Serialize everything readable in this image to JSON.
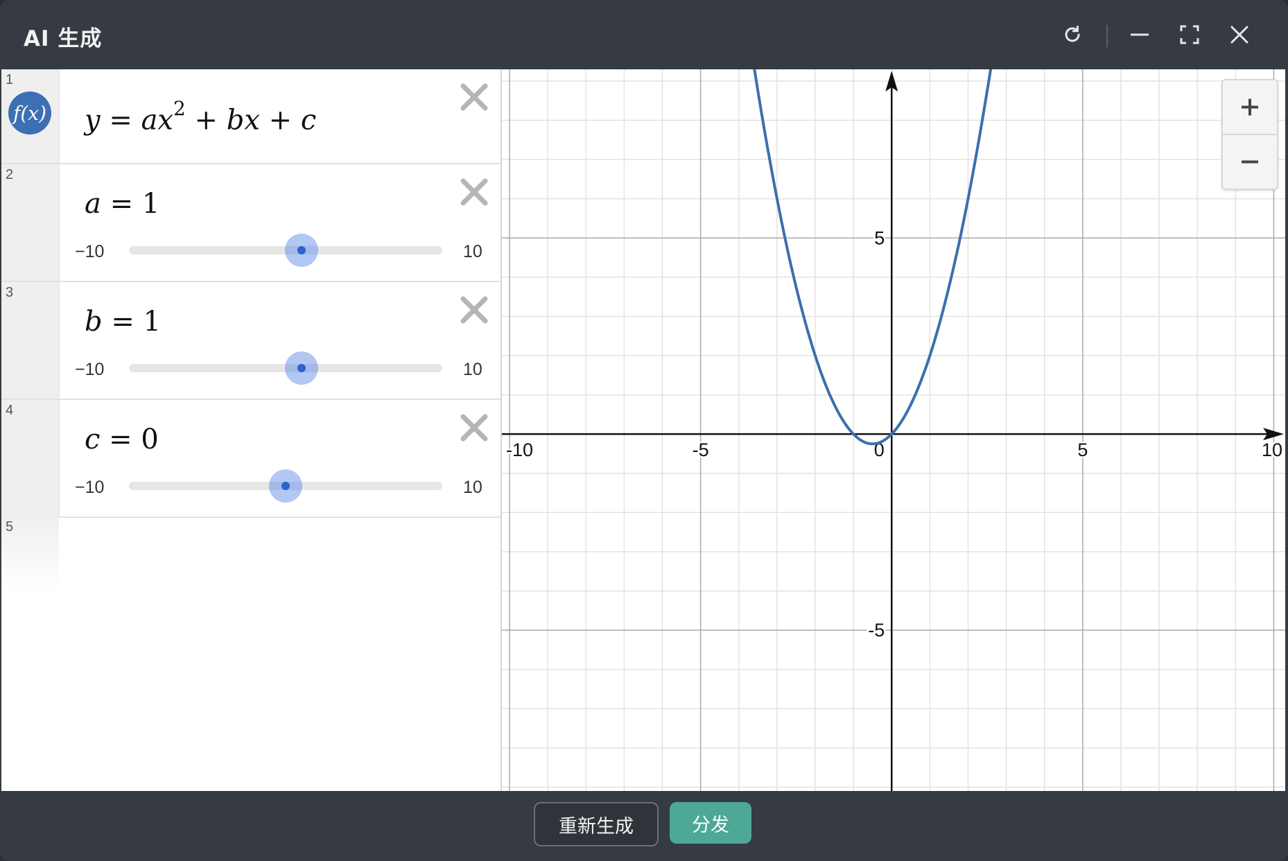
{
  "window": {
    "title": "AI 生成",
    "controls": [
      "refresh-icon",
      "minimize-icon",
      "fullscreen-icon",
      "close-icon"
    ]
  },
  "expressions": [
    {
      "num": "1",
      "icon": "fx-icon",
      "icon_label": "f(x)",
      "latex": "y = ax^2 + bx + c"
    },
    {
      "num": "2",
      "var": "a",
      "value_text": "1",
      "min": "−10",
      "max": "10",
      "value": 1
    },
    {
      "num": "3",
      "var": "b",
      "value_text": "1",
      "min": "−10",
      "max": "10",
      "value": 1
    },
    {
      "num": "4",
      "var": "c",
      "value_text": "0",
      "min": "−10",
      "max": "10",
      "value": 0
    },
    {
      "num": "5"
    }
  ],
  "graph": {
    "x_ticks": [
      "-10",
      "-5",
      "0",
      "5",
      "10"
    ],
    "y_ticks": [
      "5",
      "-5"
    ],
    "curve_color": "#3c6fad",
    "zoom_in_icon": "plus-icon",
    "zoom_out_icon": "minus-icon"
  },
  "chart_data": {
    "type": "line",
    "function": "y = x^2 + x",
    "xlim": [
      -10.2,
      10.3
    ],
    "ylim": [
      -9.1,
      9.3
    ],
    "x_major_step": 5,
    "y_major_step": 5,
    "minor_step": 1,
    "grid": true,
    "series": [
      {
        "x": [
          -3.5,
          -3,
          -2,
          -1,
          -0.5,
          0,
          1,
          2,
          2.6
        ],
        "values": [
          8.75,
          6,
          2,
          0,
          -0.25,
          0,
          2,
          6,
          9.36
        ]
      }
    ]
  },
  "footer": {
    "regenerate_label": "重新生成",
    "distribute_label": "分发",
    "accent": "#4ea896"
  }
}
